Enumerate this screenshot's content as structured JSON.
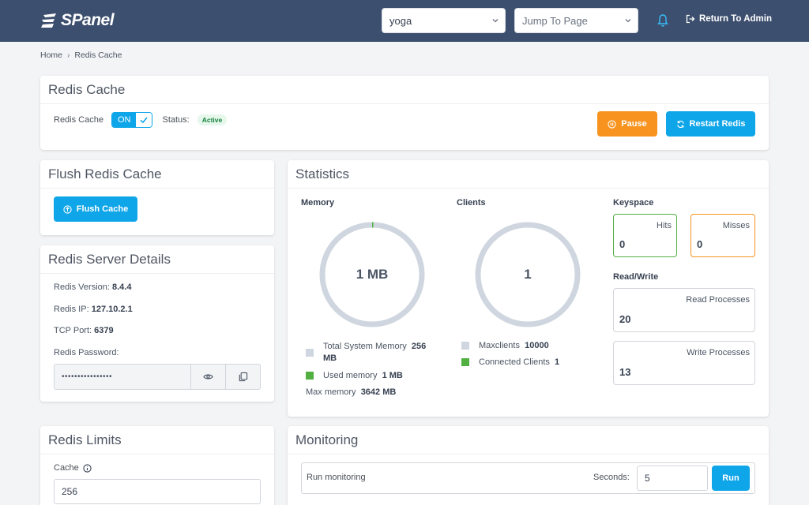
{
  "app": {
    "name": "SPanel"
  },
  "header": {
    "account_select": "yoga",
    "jump_select": "Jump To Page",
    "return_label": "Return To Admin"
  },
  "breadcrumb": {
    "home": "Home",
    "current": "Redis Cache"
  },
  "redis_cache": {
    "title": "Redis Cache",
    "toggle_label": "Redis Cache",
    "toggle_state": "ON",
    "status_label": "Status:",
    "status_value": "Active",
    "pause_label": "Pause",
    "restart_label": "Restart Redis"
  },
  "flush": {
    "title": "Flush Redis Cache",
    "button_label": "Flush Cache"
  },
  "server": {
    "title": "Redis Server Details",
    "version_label": "Redis Version:",
    "version": "8.4.4",
    "ip_label": "Redis IP:",
    "ip": "127.10.2.1",
    "port_label": "TCP Port:",
    "port": "6379",
    "password_label": "Redis Password:",
    "password_mask": "••••••••••••••••"
  },
  "statistics": {
    "title": "Statistics",
    "memory": {
      "heading": "Memory",
      "center": "1 MB",
      "used_fraction": 0.003,
      "total_label": "Total System Memory",
      "total_value": "256",
      "total_unit": "MB",
      "used_label": "Used memory",
      "used_value": "1 MB",
      "max_label": "Max memory",
      "max_value": "3642 MB"
    },
    "clients": {
      "heading": "Clients",
      "center": "1",
      "max_label": "Maxclients",
      "max_value": "10000",
      "connected_label": "Connected Clients",
      "connected_value": "1"
    },
    "keyspace": {
      "heading": "Keyspace",
      "hits_label": "Hits",
      "hits": "0",
      "misses_label": "Misses",
      "misses": "0"
    },
    "readwrite": {
      "heading": "Read/Write",
      "read_label": "Read Processes",
      "read": "20",
      "write_label": "Write Processes",
      "write": "13"
    }
  },
  "limits": {
    "title": "Redis Limits",
    "cache_label": "Cache",
    "cache_value": "256"
  },
  "monitoring": {
    "title": "Monitoring",
    "run_label": "Run monitoring",
    "seconds_label": "Seconds:",
    "seconds_value": "5",
    "run_button": "Run"
  },
  "colors": {
    "topbar": "#3d4f6e",
    "accent": "#0ea5e9",
    "orange": "#f7931e",
    "green": "#52b043",
    "donut_track": "#cfd6df"
  }
}
